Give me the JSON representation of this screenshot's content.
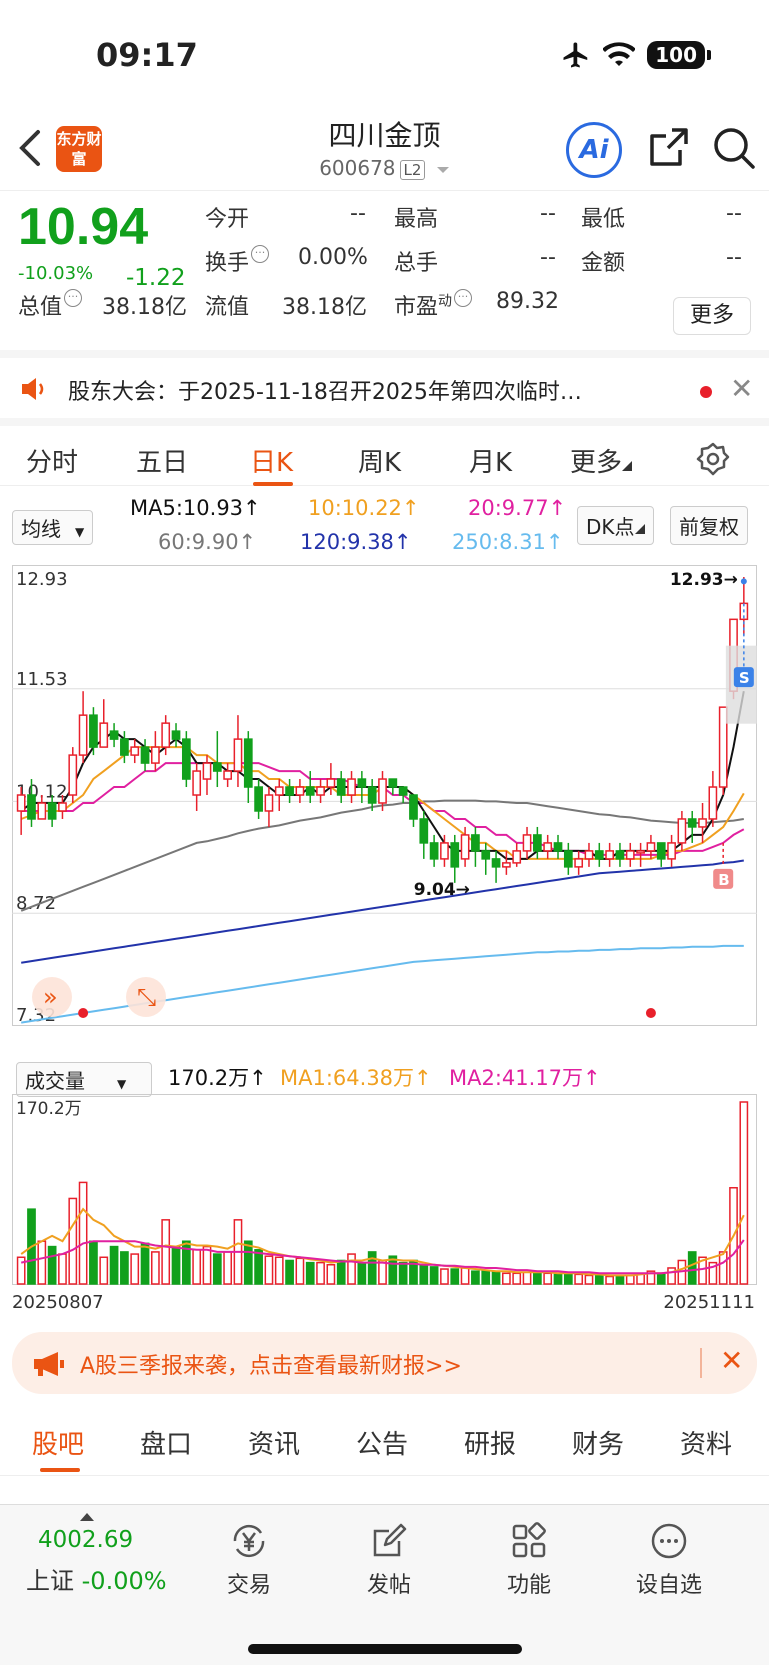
{
  "status": {
    "time": "09:17",
    "battery": "100"
  },
  "header": {
    "logo": "东方财富",
    "name": "四川金顶",
    "code": "600678",
    "level": "L2",
    "ai_label": "Ai"
  },
  "quote": {
    "price": "10.94",
    "change_pct": "-10.03%",
    "change": "-1.22",
    "open_label": "今开",
    "open": "--",
    "high_label": "最高",
    "high": "--",
    "low_label": "最低",
    "low": "--",
    "turnover_label": "换手",
    "turnover": "0.00%",
    "vol_label": "总手",
    "vol": "--",
    "amount_label": "金额",
    "amount": "--",
    "mcap_label": "总值",
    "mcap": "38.18亿",
    "float_label": "流值",
    "float": "38.18亿",
    "pe_label": "市盈",
    "pe_sup": "动",
    "pe": "89.32",
    "more": "更多"
  },
  "notice": {
    "text": "股东大会：于2025-11-18召开2025年第四次临时…"
  },
  "period_tabs": [
    "分时",
    "五日",
    "日K",
    "周K",
    "月K",
    "更多"
  ],
  "ma": {
    "select": "均线",
    "ma5": "MA5:10.93↑",
    "ma10": "10:10.22↑",
    "ma20": "20:9.77↑",
    "ma60": "60:9.90↑",
    "ma120": "120:9.38↑",
    "ma250": "250:8.31↑",
    "dk": "DK点",
    "fq": "前复权",
    "colors": {
      "ma5": "#111111",
      "ma10": "#f0a020",
      "ma20": "#e020a0",
      "ma60": "#777777",
      "ma120": "#2233aa",
      "ma250": "#66bbee"
    }
  },
  "vol_bar": {
    "select": "成交量",
    "vol": "170.2万↑",
    "ma1": "MA1:64.38万↑",
    "ma2": "MA2:41.17万↑"
  },
  "chart_data": {
    "type": "candlestick",
    "y_ticks": [
      "12.93",
      "11.53",
      "10.12",
      "8.72",
      "7.32"
    ],
    "ylim": [
      7.32,
      12.93
    ],
    "annotations": {
      "high": "12.93→",
      "low": "9.04→",
      "sell": "S",
      "buy": "B"
    },
    "vol_max_label": "170.2万",
    "x_start": "20250807",
    "x_end": "20251111",
    "candles": [
      [
        10.0,
        10.2,
        9.7,
        10.3
      ],
      [
        10.2,
        9.9,
        9.8,
        10.4
      ],
      [
        9.9,
        10.1,
        9.9,
        10.2
      ],
      [
        10.1,
        9.9,
        9.8,
        10.2
      ],
      [
        10.0,
        10.1,
        9.9,
        10.2
      ],
      [
        10.2,
        10.7,
        10.1,
        10.8
      ],
      [
        10.7,
        11.2,
        10.6,
        11.5
      ],
      [
        11.2,
        10.8,
        10.7,
        11.3
      ],
      [
        10.8,
        11.1,
        10.8,
        11.4
      ],
      [
        11.0,
        10.9,
        10.8,
        11.1
      ],
      [
        10.9,
        10.7,
        10.6,
        11.0
      ],
      [
        10.7,
        10.8,
        10.6,
        10.9
      ],
      [
        10.8,
        10.6,
        10.5,
        10.9
      ],
      [
        10.6,
        10.8,
        10.5,
        11.0
      ],
      [
        10.8,
        11.1,
        10.7,
        11.2
      ],
      [
        11.0,
        10.9,
        10.8,
        11.1
      ],
      [
        10.9,
        10.4,
        10.3,
        11.0
      ],
      [
        10.2,
        10.5,
        10.0,
        10.6
      ],
      [
        10.4,
        10.6,
        10.2,
        10.7
      ],
      [
        10.6,
        10.5,
        10.3,
        11.0
      ],
      [
        10.4,
        10.5,
        10.3,
        10.6
      ],
      [
        10.5,
        10.9,
        10.3,
        11.2
      ],
      [
        10.9,
        10.3,
        10.1,
        11.0
      ],
      [
        10.3,
        10.0,
        9.9,
        10.4
      ],
      [
        10.0,
        10.2,
        9.8,
        10.3
      ],
      [
        10.2,
        10.3,
        10.0,
        10.4
      ],
      [
        10.3,
        10.2,
        10.1,
        10.4
      ],
      [
        10.2,
        10.3,
        10.1,
        10.4
      ],
      [
        10.3,
        10.2,
        10.1,
        10.5
      ],
      [
        10.2,
        10.3,
        10.1,
        10.4
      ],
      [
        10.3,
        10.4,
        10.2,
        10.6
      ],
      [
        10.4,
        10.2,
        10.1,
        10.5
      ],
      [
        10.2,
        10.4,
        10.1,
        10.5
      ],
      [
        10.4,
        10.3,
        10.1,
        10.5
      ],
      [
        10.3,
        10.1,
        10.0,
        10.4
      ],
      [
        10.1,
        10.4,
        10.0,
        10.5
      ],
      [
        10.4,
        10.3,
        10.2,
        10.4
      ],
      [
        10.3,
        10.2,
        10.1,
        10.3
      ],
      [
        10.2,
        9.9,
        9.8,
        10.2
      ],
      [
        9.9,
        9.6,
        9.4,
        10.0
      ],
      [
        9.6,
        9.4,
        9.3,
        9.7
      ],
      [
        9.4,
        9.6,
        9.3,
        9.7
      ],
      [
        9.6,
        9.3,
        9.1,
        9.7
      ],
      [
        9.4,
        9.7,
        9.3,
        9.8
      ],
      [
        9.7,
        9.5,
        9.3,
        9.8
      ],
      [
        9.5,
        9.4,
        9.2,
        9.6
      ],
      [
        9.4,
        9.3,
        9.1,
        9.5
      ],
      [
        9.3,
        9.35,
        9.2,
        9.5
      ],
      [
        9.35,
        9.5,
        9.3,
        9.6
      ],
      [
        9.5,
        9.7,
        9.4,
        9.8
      ],
      [
        9.7,
        9.5,
        9.4,
        9.8
      ],
      [
        9.5,
        9.6,
        9.4,
        9.7
      ],
      [
        9.6,
        9.5,
        9.4,
        9.7
      ],
      [
        9.5,
        9.3,
        9.2,
        9.6
      ],
      [
        9.3,
        9.4,
        9.2,
        9.5
      ],
      [
        9.4,
        9.5,
        9.3,
        9.6
      ],
      [
        9.5,
        9.4,
        9.3,
        9.6
      ],
      [
        9.4,
        9.5,
        9.3,
        9.6
      ],
      [
        9.5,
        9.4,
        9.3,
        9.6
      ],
      [
        9.4,
        9.5,
        9.3,
        9.6
      ],
      [
        9.5,
        9.5,
        9.3,
        9.6
      ],
      [
        9.5,
        9.6,
        9.4,
        9.7
      ],
      [
        9.6,
        9.4,
        9.3,
        9.6
      ],
      [
        9.4,
        9.6,
        9.3,
        9.7
      ],
      [
        9.6,
        9.9,
        9.5,
        10.0
      ],
      [
        9.9,
        9.8,
        9.6,
        10.0
      ],
      [
        9.8,
        9.9,
        9.6,
        10.1
      ],
      [
        9.9,
        10.3,
        9.8,
        10.5
      ],
      [
        10.3,
        11.3,
        10.2,
        11.3
      ],
      [
        11.5,
        12.4,
        11.4,
        12.4
      ],
      [
        12.4,
        12.6,
        12.2,
        12.93
      ]
    ],
    "ma5": [
      10.0,
      10.1,
      10.1,
      10.1,
      10.1,
      10.3,
      10.6,
      10.8,
      10.9,
      11.0,
      10.9,
      10.9,
      10.8,
      10.7,
      10.8,
      10.9,
      10.8,
      10.6,
      10.6,
      10.6,
      10.5,
      10.5,
      10.4,
      10.4,
      10.3,
      10.2,
      10.2,
      10.2,
      10.3,
      10.2,
      10.3,
      10.3,
      10.3,
      10.3,
      10.3,
      10.3,
      10.3,
      10.3,
      10.2,
      10.0,
      9.8,
      9.6,
      9.5,
      9.5,
      9.5,
      9.5,
      9.5,
      9.4,
      9.4,
      9.4,
      9.5,
      9.5,
      9.5,
      9.5,
      9.5,
      9.5,
      9.4,
      9.4,
      9.5,
      9.5,
      9.5,
      9.5,
      9.5,
      9.5,
      9.6,
      9.7,
      9.7,
      9.9,
      10.2,
      10.8,
      11.5
    ],
    "ma10": [
      9.9,
      9.95,
      10.0,
      10.0,
      10.0,
      10.1,
      10.2,
      10.4,
      10.5,
      10.6,
      10.7,
      10.8,
      10.8,
      10.8,
      10.8,
      10.8,
      10.8,
      10.7,
      10.7,
      10.6,
      10.6,
      10.6,
      10.5,
      10.5,
      10.4,
      10.4,
      10.3,
      10.3,
      10.3,
      10.3,
      10.3,
      10.2,
      10.2,
      10.2,
      10.2,
      10.3,
      10.3,
      10.3,
      10.2,
      10.1,
      10.0,
      9.9,
      9.8,
      9.7,
      9.6,
      9.6,
      9.5,
      9.5,
      9.4,
      9.4,
      9.4,
      9.4,
      9.4,
      9.4,
      9.4,
      9.4,
      9.4,
      9.4,
      9.4,
      9.4,
      9.4,
      9.4,
      9.45,
      9.5,
      9.5,
      9.55,
      9.6,
      9.7,
      9.8,
      10.0,
      10.22
    ],
    "ma20": [
      10.0,
      10.0,
      10.0,
      10.0,
      10.0,
      10.0,
      10.1,
      10.1,
      10.2,
      10.3,
      10.3,
      10.4,
      10.5,
      10.5,
      10.6,
      10.6,
      10.6,
      10.6,
      10.6,
      10.6,
      10.6,
      10.6,
      10.6,
      10.6,
      10.55,
      10.5,
      10.5,
      10.5,
      10.4,
      10.4,
      10.4,
      10.4,
      10.35,
      10.3,
      10.3,
      10.3,
      10.2,
      10.2,
      10.1,
      10.1,
      10.0,
      10.0,
      9.9,
      9.9,
      9.8,
      9.8,
      9.7,
      9.7,
      9.6,
      9.6,
      9.6,
      9.55,
      9.5,
      9.5,
      9.5,
      9.45,
      9.45,
      9.45,
      9.45,
      9.45,
      9.45,
      9.45,
      9.45,
      9.45,
      9.5,
      9.5,
      9.5,
      9.55,
      9.6,
      9.7,
      9.77
    ],
    "ma60": [
      8.75,
      8.8,
      8.85,
      8.9,
      8.95,
      9.0,
      9.05,
      9.1,
      9.15,
      9.2,
      9.25,
      9.3,
      9.35,
      9.4,
      9.45,
      9.5,
      9.55,
      9.6,
      9.62,
      9.65,
      9.68,
      9.72,
      9.75,
      9.78,
      9.8,
      9.82,
      9.85,
      9.88,
      9.9,
      9.92,
      9.95,
      9.98,
      10.0,
      10.02,
      10.05,
      10.07,
      10.08,
      10.1,
      10.1,
      10.12,
      10.12,
      10.13,
      10.13,
      10.13,
      10.13,
      10.12,
      10.12,
      10.11,
      10.1,
      10.1,
      10.08,
      10.06,
      10.04,
      10.02,
      10.0,
      9.98,
      9.96,
      9.95,
      9.93,
      9.92,
      9.9,
      9.88,
      9.87,
      9.86,
      9.85,
      9.85,
      9.85,
      9.86,
      9.87,
      9.88,
      9.9
    ],
    "ma120": [
      8.1,
      8.12,
      8.14,
      8.16,
      8.18,
      8.2,
      8.22,
      8.24,
      8.26,
      8.28,
      8.3,
      8.32,
      8.34,
      8.36,
      8.38,
      8.4,
      8.42,
      8.44,
      8.46,
      8.48,
      8.5,
      8.52,
      8.54,
      8.56,
      8.58,
      8.6,
      8.62,
      8.64,
      8.66,
      8.68,
      8.7,
      8.72,
      8.74,
      8.76,
      8.78,
      8.8,
      8.82,
      8.84,
      8.86,
      8.88,
      8.9,
      8.92,
      8.94,
      8.96,
      8.98,
      9.0,
      9.02,
      9.04,
      9.06,
      9.08,
      9.1,
      9.12,
      9.14,
      9.16,
      9.18,
      9.2,
      9.22,
      9.23,
      9.24,
      9.25,
      9.26,
      9.27,
      9.28,
      9.29,
      9.3,
      9.31,
      9.32,
      9.33,
      9.35,
      9.36,
      9.38
    ],
    "ma250": [
      7.35,
      7.37,
      7.39,
      7.41,
      7.43,
      7.45,
      7.47,
      7.49,
      7.51,
      7.53,
      7.55,
      7.57,
      7.59,
      7.61,
      7.63,
      7.65,
      7.67,
      7.69,
      7.71,
      7.73,
      7.75,
      7.77,
      7.79,
      7.81,
      7.83,
      7.85,
      7.87,
      7.89,
      7.91,
      7.93,
      7.95,
      7.97,
      7.99,
      8.01,
      8.03,
      8.05,
      8.07,
      8.09,
      8.11,
      8.12,
      8.13,
      8.14,
      8.15,
      8.16,
      8.17,
      8.18,
      8.19,
      8.2,
      8.21,
      8.22,
      8.23,
      8.23,
      8.24,
      8.24,
      8.25,
      8.25,
      8.26,
      8.26,
      8.27,
      8.27,
      8.28,
      8.28,
      8.28,
      8.29,
      8.29,
      8.3,
      8.3,
      8.3,
      8.31,
      8.31,
      8.31
    ],
    "volume_wan": [
      25,
      70,
      40,
      35,
      28,
      80,
      95,
      40,
      25,
      35,
      30,
      28,
      38,
      30,
      60,
      35,
      40,
      32,
      35,
      28,
      30,
      60,
      40,
      32,
      26,
      25,
      22,
      24,
      20,
      20,
      18,
      22,
      28,
      20,
      30,
      22,
      26,
      20,
      22,
      18,
      16,
      14,
      14,
      15,
      12,
      12,
      11,
      10,
      10,
      11,
      12,
      10,
      9,
      10,
      9,
      8,
      8,
      7,
      8,
      8,
      10,
      12,
      10,
      15,
      22,
      30,
      25,
      20,
      30,
      90,
      170.2
    ],
    "vol_ma1": [
      28,
      35,
      40,
      45,
      40,
      55,
      70,
      60,
      55,
      45,
      40,
      35,
      35,
      33,
      36,
      35,
      38,
      36,
      36,
      35,
      33,
      38,
      36,
      34,
      30,
      28,
      26,
      25,
      23,
      22,
      20,
      21,
      22,
      22,
      24,
      22,
      23,
      22,
      22,
      20,
      18,
      17,
      16,
      15,
      14,
      13,
      12,
      12,
      11,
      11,
      11,
      11,
      10,
      10,
      10,
      9,
      9,
      8,
      8,
      8,
      9,
      10,
      10,
      11,
      14,
      18,
      22,
      25,
      28,
      45,
      64.38
    ],
    "vol_ma2": [
      20,
      22,
      24,
      26,
      28,
      32,
      38,
      40,
      40,
      40,
      40,
      40,
      38,
      36,
      35,
      34,
      33,
      32,
      32,
      30,
      30,
      30,
      30,
      29,
      28,
      27,
      26,
      25,
      24,
      23,
      22,
      21,
      21,
      20,
      20,
      20,
      19,
      19,
      19,
      18,
      18,
      17,
      17,
      16,
      16,
      15,
      15,
      14,
      13,
      13,
      12,
      12,
      12,
      11,
      11,
      11,
      10,
      10,
      10,
      10,
      10,
      10,
      10,
      11,
      12,
      13,
      14,
      16,
      20,
      28,
      41.17
    ],
    "markers": {
      "high_index": 70,
      "low_index": 45,
      "red_dots_index": [
        6,
        61
      ]
    }
  },
  "banner": {
    "text": "A股三季报来袭，点击查看最新财报>>"
  },
  "bottom_tabs": [
    "股吧",
    "盘口",
    "资讯",
    "公告",
    "研报",
    "财务",
    "资料"
  ],
  "footer": {
    "index_value": "4002.69",
    "index_name": "上证",
    "index_change": "-0.00%",
    "items": [
      "交易",
      "发帖",
      "功能",
      "设自选"
    ]
  }
}
